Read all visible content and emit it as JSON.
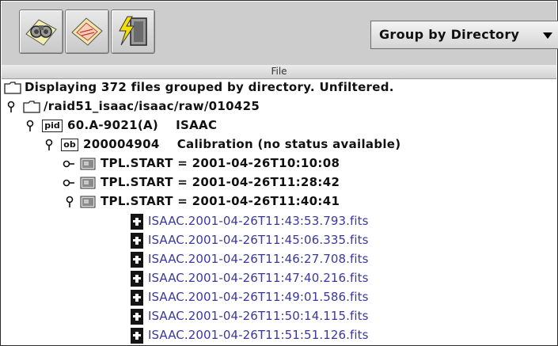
{
  "toolbar": {
    "buttons": [
      {
        "icon": "binoculars-icon"
      },
      {
        "icon": "filter-icon"
      },
      {
        "icon": "lightning-exit-icon"
      }
    ],
    "group_select": {
      "selected": "Group by Directory"
    }
  },
  "table": {
    "column_header": "File"
  },
  "tree": {
    "summary": "Displaying 372 files grouped by directory. Unfiltered.",
    "directory": "/raid51_isaac/isaac/raw/010425",
    "program": {
      "badge": "pid",
      "label": "60.A-9021(A)    ISAAC"
    },
    "observation_block": {
      "badge": "ob",
      "label": "200004904    Calibration (no status available)"
    },
    "templates": [
      {
        "label": "TPL.START = 2001-04-26T10:10:08",
        "expanded": false
      },
      {
        "label": "TPL.START = 2001-04-26T11:28:42",
        "expanded": false
      },
      {
        "label": "TPL.START = 2001-04-26T11:40:41",
        "expanded": true
      }
    ],
    "files": [
      "ISAAC.2001-04-26T11:43:53.793.fits",
      "ISAAC.2001-04-26T11:45:06.335.fits",
      "ISAAC.2001-04-26T11:46:27.708.fits",
      "ISAAC.2001-04-26T11:47:40.216.fits",
      "ISAAC.2001-04-26T11:49:01.586.fits",
      "ISAAC.2001-04-26T11:50:14.115.fits",
      "ISAAC.2001-04-26T11:51:51.126.fits"
    ]
  }
}
